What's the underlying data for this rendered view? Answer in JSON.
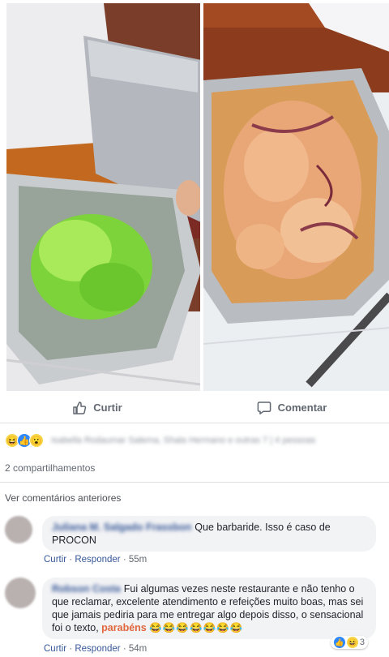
{
  "post": {
    "actions": {
      "like_label": "Curtir",
      "comment_label": "Comentar"
    },
    "reactions": {
      "icons": [
        "haha",
        "like",
        "wow"
      ],
      "names_text": "Isabella Rodaumar Salema, Shala Hermano e outras 7 | 4 pessoas"
    },
    "shares_text": "2 compartilhamentos",
    "view_previous_comments": "Ver comentários anteriores"
  },
  "comments": [
    {
      "author": "Juliana M. Salgado Frassbon",
      "text": "Que barbaride. Isso é caso de PROCON",
      "like_link": "Curtir",
      "reply_link": "Responder",
      "time": "55m"
    },
    {
      "author": "Robson Costa",
      "text": "Fui algumas vezes neste restaurante e não tenho o que reclamar, excelente atendimento e refeições muito boas, mas sei que jamais pediria para me entregar algo depois disso, o sensacional foi o texto,",
      "highlight": "parabéns",
      "emojis": "😂😂😂😂😂😂😂",
      "like_link": "Curtir",
      "reply_link": "Responder",
      "time": "54m",
      "reaction_count": "3"
    }
  ],
  "colors": {
    "link_blue": "#385898",
    "meta_gray": "#606770",
    "bubble_bg": "#f2f3f5",
    "highlight": "#e0663d"
  }
}
